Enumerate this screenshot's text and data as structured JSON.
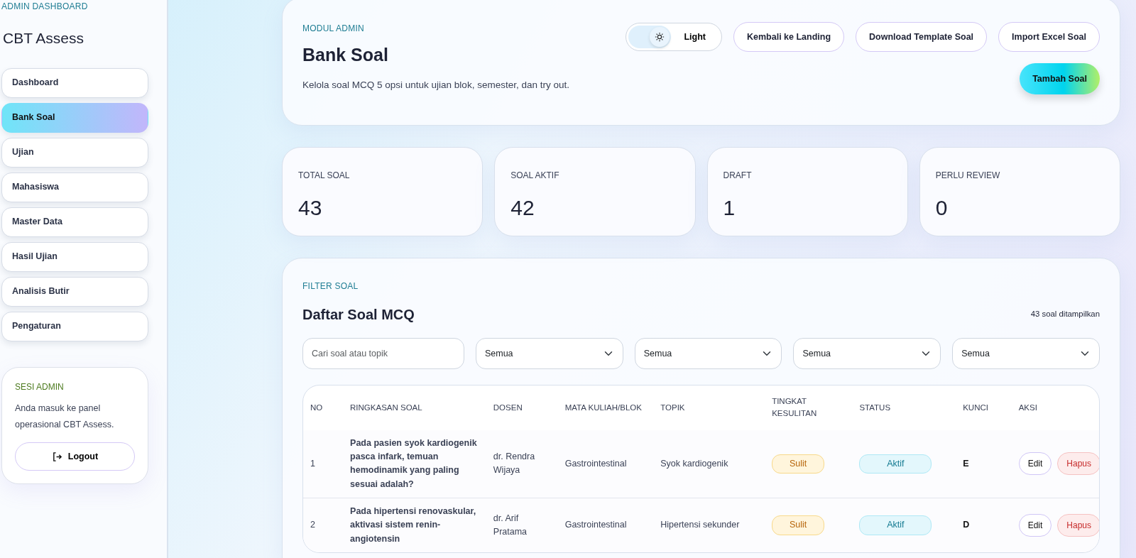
{
  "sidebar": {
    "eyebrow": "ADMIN DASHBOARD",
    "title": "CBT Assess",
    "items": [
      {
        "label": "Dashboard",
        "selected": false
      },
      {
        "label": "Bank Soal",
        "selected": true
      },
      {
        "label": "Ujian",
        "selected": false
      },
      {
        "label": "Mahasiswa",
        "selected": false
      },
      {
        "label": "Master Data",
        "selected": false
      },
      {
        "label": "Hasil Ujian",
        "selected": false
      },
      {
        "label": "Analisis Butir",
        "selected": false
      },
      {
        "label": "Pengaturan",
        "selected": false
      }
    ],
    "session": {
      "eyebrow": "SESI ADMIN",
      "text": "Anda masuk ke panel operasional CBT Assess.",
      "button": "Logout"
    }
  },
  "header": {
    "eyebrow": "MODUL ADMIN",
    "title": "Bank Soal",
    "description": "Kelola soal MCQ 5 opsi untuk ujian blok, semester, dan try out.",
    "theme_toggle": {
      "label": "Light"
    },
    "buttons": [
      "Kembali ke Landing",
      "Download Template Soal",
      "Import Excel Soal"
    ],
    "primary_button": "Tambah Soal"
  },
  "stats": [
    {
      "label": "TOTAL SOAL",
      "value": "43"
    },
    {
      "label": "SOAL AKTIF",
      "value": "42"
    },
    {
      "label": "DRAFT",
      "value": "1"
    },
    {
      "label": "PERLU REVIEW",
      "value": "0"
    }
  ],
  "list": {
    "eyebrow": "FILTER SOAL",
    "title": "Daftar Soal MCQ",
    "count": "43 soal ditampilkan",
    "search": {
      "placeholder": "Cari soal atau topik"
    },
    "filters": [
      "Semua",
      "Semua",
      "Semua",
      "Semua"
    ],
    "table": {
      "columns": [
        "NO",
        "RINGKASAN SOAL",
        "DOSEN",
        "MATA KULIAH/BLOK",
        "TOPIK",
        "TINGKAT KESULITAN",
        "STATUS",
        "KUNCI",
        "AKSI"
      ],
      "rows": [
        {
          "no": "1",
          "summary": "Pada pasien syok kardiogenik pasca infark, temuan hemodinamik yang paling sesuai adalah?",
          "lecturer": "dr. Rendra Wijaya",
          "course": "Gastrointestinal",
          "topic": "Syok kardiogenik",
          "difficulty": "Sulit",
          "status": "Aktif",
          "key": "E",
          "actions": [
            "Edit",
            "Hapus"
          ]
        },
        {
          "no": "2",
          "summary": "Pada hipertensi renovaskular, aktivasi sistem renin-angiotensin",
          "lecturer": "dr. Arif Pratama",
          "course": "Gastrointestinal",
          "topic": "Hipertensi sekunder",
          "difficulty": "Sulit",
          "status": "Aktif",
          "key": "D",
          "actions": [
            "Edit",
            "Hapus"
          ]
        }
      ]
    }
  }
}
